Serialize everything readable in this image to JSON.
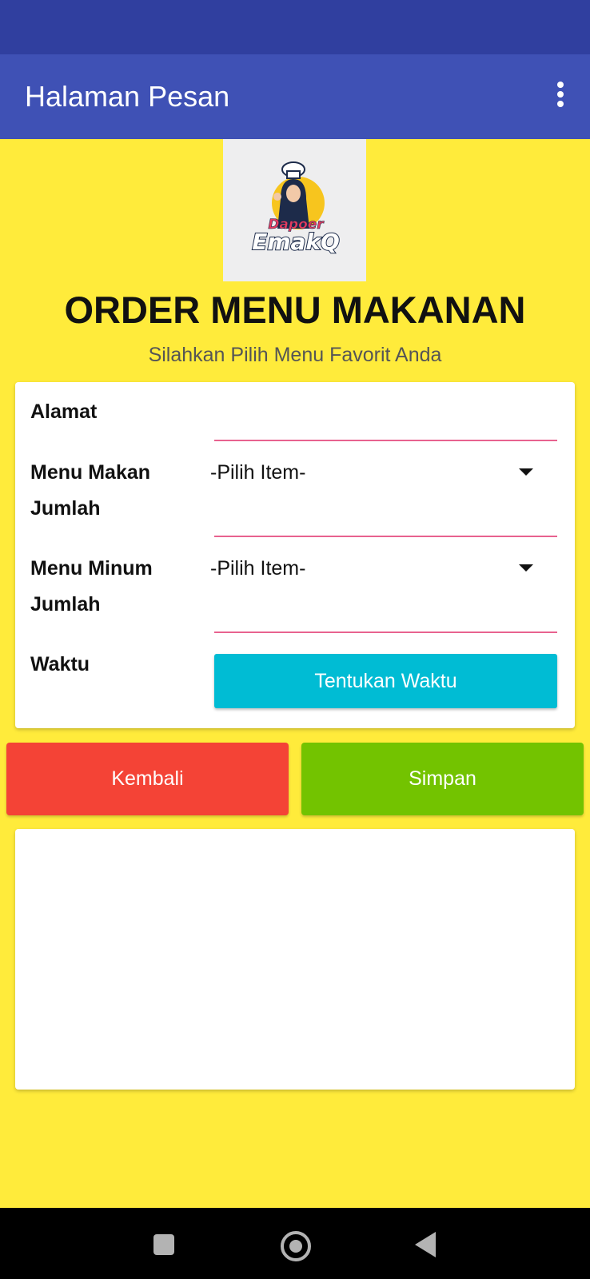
{
  "app_bar": {
    "title": "Halaman Pesan",
    "overflow_icon": "more-vert-icon"
  },
  "logo": {
    "brand_line1": "Dapoer",
    "brand_line2": "EmakQ"
  },
  "heading": "ORDER MENU MAKANAN",
  "subheading": "Silahkan Pilih Menu Favorit Anda",
  "form": {
    "alamat_label": "Alamat",
    "alamat_value": "",
    "menu_makan_label": "Menu Makan",
    "menu_makan_selected": "-Pilih Item-",
    "jumlah_makan_label": "Jumlah",
    "jumlah_makan_value": "",
    "menu_minum_label": "Menu Minum",
    "menu_minum_selected": "-Pilih Item-",
    "jumlah_minum_label": "Jumlah",
    "jumlah_minum_value": "",
    "waktu_label": "Waktu",
    "waktu_button": "Tentukan Waktu"
  },
  "buttons": {
    "kembali": "Kembali",
    "simpan": "Simpan"
  },
  "colors": {
    "background": "#ffeb3b",
    "status_bar": "#303f9f",
    "app_bar": "#3f51b5",
    "waktu_button": "#00bcd4",
    "kembali_button": "#f44336",
    "simpan_button": "#73c300",
    "input_underline": "#e8628f"
  },
  "nav_bar": {
    "icons": [
      "recents-square-icon",
      "home-circle-icon",
      "back-triangle-icon"
    ]
  }
}
